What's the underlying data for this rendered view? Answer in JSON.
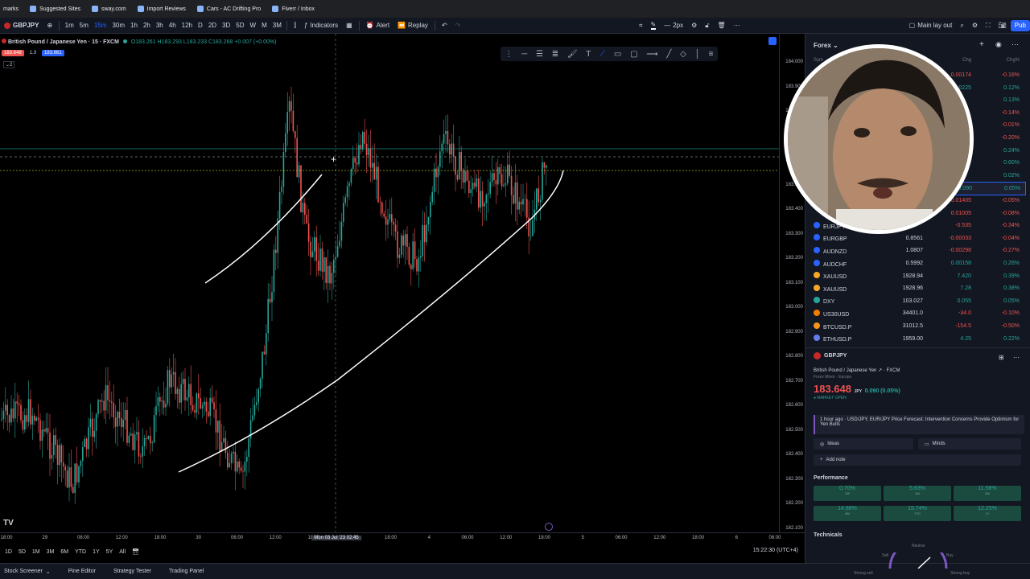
{
  "browser": {
    "bookmarks": [
      "marks",
      "Suggested Sites",
      "sway.com",
      "Import Reviews",
      "Cars - AC Drifting Pro",
      "Fiverr / Inbox"
    ]
  },
  "toolbar": {
    "symbol": "GBPJPY",
    "intervals": [
      "1m",
      "5m",
      "15m",
      "30m",
      "1h",
      "2h",
      "3h",
      "4h",
      "12h",
      "D",
      "2D",
      "3D",
      "5D",
      "W",
      "M",
      "3M"
    ],
    "active_interval": "15m",
    "indicators_label": "Indicators",
    "alert_label": "Alert",
    "replay_label": "Replay",
    "stroke_label": "2px",
    "layout_label": "Main lay out"
  },
  "chart": {
    "legend_title": "British Pound / Japanese Yen · 15 · FXCM",
    "ohlc": "O183.261 H183.293 L183.233 C183.268 +0.007 (+0.00%)",
    "bid": "183.648",
    "ask": "183.661",
    "spread": "1.3",
    "indicator_count": "2",
    "price_ticks": [
      "184.000",
      "183.900",
      "183.800",
      "183.700",
      "183.600",
      "183.500",
      "183.400",
      "183.300",
      "183.200",
      "183.100",
      "183.000",
      "182.900",
      "182.800",
      "182.700",
      "182.600",
      "182.500",
      "182.400",
      "182.300",
      "182.200",
      "182.100"
    ],
    "time_ticks": [
      "18:00",
      "29",
      "06:00",
      "12:00",
      "18:00",
      "30",
      "06:00",
      "12:00",
      "18:00",
      "12:00",
      "18:00",
      "4",
      "06:00",
      "12:00",
      "18:00",
      "5",
      "06:00",
      "12:00",
      "18:00",
      "6",
      "06:00"
    ],
    "crosshair_time": "Mon 03 Jul '23  02:45",
    "logo": "TV"
  },
  "rangebar": {
    "ranges": [
      "1D",
      "5D",
      "1M",
      "3M",
      "6M",
      "YTD",
      "1Y",
      "5Y",
      "All"
    ],
    "clock": "15:22:30 (UTC+4)"
  },
  "bottombar": {
    "tabs": [
      "Stock Screener",
      "Pine Editor",
      "Strategy Tester",
      "Trading Panel"
    ]
  },
  "watchlist": {
    "title": "Forex",
    "col_sym": "Sym",
    "col_chg": "Chg",
    "col_pct": "Chg%",
    "rows": [
      {
        "sym": "",
        "last": "",
        "chg": "0.00174",
        "pct": "-0.16%",
        "dir": "neg",
        "color": "#ef5350"
      },
      {
        "sym": "",
        "last": "",
        "chg": "0.0225",
        "pct": "0.12%",
        "dir": "pos",
        "color": "#26a69a"
      },
      {
        "sym": "",
        "last": "",
        "chg": "",
        "pct": "0.13%",
        "dir": "pos",
        "color": "#26a69a"
      },
      {
        "sym": "",
        "last": "",
        "chg": "",
        "pct": "-0.14%",
        "dir": "neg",
        "color": "#ef5350"
      },
      {
        "sym": "",
        "last": "",
        "chg": "",
        "pct": "-0.01%",
        "dir": "neg",
        "color": "#ef5350"
      },
      {
        "sym": "",
        "last": "",
        "chg": "",
        "pct": "-0.20%",
        "dir": "neg",
        "color": "#ef5350"
      },
      {
        "sym": "",
        "last": "",
        "chg": "",
        "pct": "0.24%",
        "dir": "pos",
        "color": "#26a69a"
      },
      {
        "sym": "",
        "last": "",
        "chg": "",
        "pct": "0.60%",
        "dir": "pos",
        "color": "#26a69a"
      },
      {
        "sym": "",
        "last": "",
        "chg": "",
        "pct": "0.02%",
        "dir": "pos",
        "color": "#26a69a"
      },
      {
        "sym": "",
        "last": "",
        "chg": "0.090",
        "pct": "0.05%",
        "dir": "pos",
        "color": "#26a69a"
      },
      {
        "sym": "",
        "last": "",
        "chg": "-0.01405",
        "pct": "-0.05%",
        "dir": "neg",
        "color": "#ef5350"
      },
      {
        "sym": "",
        "last": "",
        "chg": "0.01005",
        "pct": "-0.08%",
        "dir": "neg",
        "color": "#ef5350"
      },
      {
        "sym": "EURJPY",
        "last": "",
        "chg": "-0.535",
        "pct": "-0.34%",
        "dir": "neg",
        "color": "#2962ff"
      },
      {
        "sym": "EURGBP",
        "last": "0.8561",
        "chg": "-0.00033",
        "pct": "-0.04%",
        "dir": "neg",
        "color": "#2962ff"
      },
      {
        "sym": "AUDNZD",
        "last": "1.0807",
        "chg": "-0.00298",
        "pct": "-0.27%",
        "dir": "neg",
        "color": "#2962ff"
      },
      {
        "sym": "AUDCHF",
        "last": "0.5992",
        "chg": "0.00158",
        "pct": "0.26%",
        "dir": "pos",
        "color": "#2962ff"
      },
      {
        "sym": "XAUUSD",
        "last": "1928.94",
        "chg": "7.420",
        "pct": "0.39%",
        "dir": "pos",
        "color": "#f9a825"
      },
      {
        "sym": "XAUUSD",
        "last": "1928.96",
        "chg": "7.28",
        "pct": "0.38%",
        "dir": "pos",
        "color": "#f9a825"
      },
      {
        "sym": "DXY",
        "last": "103.027",
        "chg": "0.055",
        "pct": "0.05%",
        "dir": "pos",
        "color": "#26a69a"
      },
      {
        "sym": "US30USD",
        "last": "34401.0",
        "chg": "-34.0",
        "pct": "-0.10%",
        "dir": "neg",
        "color": "#f57c00"
      },
      {
        "sym": "BTCUSD.P",
        "last": "31012.5",
        "chg": "-154.5",
        "pct": "-0.50%",
        "dir": "neg",
        "color": "#f7931a"
      },
      {
        "sym": "ETHUSD.P",
        "last": "1959.00",
        "chg": "4.25",
        "pct": "0.22%",
        "dir": "pos",
        "color": "#627eea"
      }
    ]
  },
  "details": {
    "symbol": "GBPJPY",
    "name": "British Pound / Japanese Yen",
    "exchange_tag": "FXCM",
    "sub": "Forex Minor · Europe",
    "price": "183.648",
    "currency": "JPY",
    "change": "0.090 (0.05%)",
    "market": "MARKET OPEN",
    "news": "1 hour ago · USD/JPY, EUR/JPY Price Forecast: Intervention Concerns Provide Optimism for Yen Bulls",
    "ideas": "Ideas",
    "minds": "Minds",
    "add_note": "Add note",
    "performance_title": "Performance",
    "performance": [
      {
        "value": "0.70%",
        "label": "1W"
      },
      {
        "value": "5.63%",
        "label": "1M"
      },
      {
        "value": "11.58%",
        "label": "3M"
      },
      {
        "value": "14.88%",
        "label": "6M"
      },
      {
        "value": "15.74%",
        "label": "YTD"
      },
      {
        "value": "12.25%",
        "label": "1Y"
      }
    ],
    "technicals_title": "Technicals",
    "gauge_labels": [
      "Neutral",
      "Sell",
      "Buy",
      "Strong sell",
      "Strong buy"
    ]
  },
  "colors": {
    "up": "#26a69a",
    "down": "#ef5350",
    "accent": "#2962ff",
    "bg": "#000000",
    "panel": "#131722"
  }
}
